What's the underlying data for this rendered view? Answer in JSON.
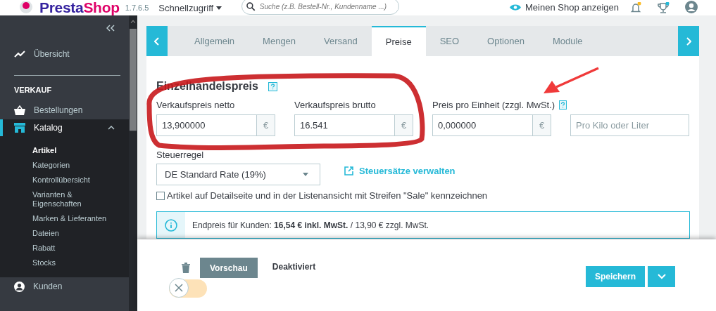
{
  "header": {
    "logo": "PrestaShop",
    "version": "1.7.6.5",
    "quick_access": "Schnellzugriff",
    "search": {
      "placeholder": "Suche (z.B. Bestell-Nr., Kundenname ...)"
    },
    "view_shop": "Meinen Shop anzeigen"
  },
  "sidebar": {
    "top": [
      {
        "label": "Übersicht",
        "kind": "trend"
      }
    ],
    "section": "VERKAUF",
    "items": [
      {
        "label": "Bestellungen",
        "kind": "basket",
        "selected": false
      },
      {
        "label": "Katalog",
        "kind": "store",
        "selected": true,
        "expanded": true,
        "children": [
          {
            "label": "Artikel",
            "selected": true
          },
          {
            "label": "Kategorien",
            "selected": false
          },
          {
            "label": "Kontrollübersicht",
            "selected": false
          },
          {
            "label": "Varianten & Eigenschaften",
            "selected": false
          },
          {
            "label": "Marken & Lieferanten",
            "selected": false
          },
          {
            "label": "Dateien",
            "selected": false
          },
          {
            "label": "Rabatt",
            "selected": false
          },
          {
            "label": "Stocks",
            "selected": false
          }
        ]
      },
      {
        "label": "Kunden",
        "kind": "user",
        "selected": false
      }
    ]
  },
  "tabs": [
    {
      "label": "Allgemein",
      "selected": false
    },
    {
      "label": "Mengen",
      "selected": false
    },
    {
      "label": "Versand",
      "selected": false
    },
    {
      "label": "Preise",
      "selected": true
    },
    {
      "label": "SEO",
      "selected": false
    },
    {
      "label": "Optionen",
      "selected": false
    },
    {
      "label": "Module",
      "selected": false
    }
  ],
  "pricing": {
    "title": "Einzelhandelspreis",
    "fields": [
      {
        "label": "Verkaufspreis netto",
        "value": "13,900000",
        "addon": "€",
        "help": false
      },
      {
        "label": "Verkaufspreis brutto",
        "value": "16.541",
        "addon": "€",
        "help": false
      },
      {
        "label": "Preis pro Einheit (zzgl. MwSt.)",
        "value": "0,000000",
        "addon": "€",
        "help": true
      },
      {
        "placeholder": "Pro Kilo oder Liter",
        "help": false
      }
    ],
    "tax_rule": {
      "label": "Steuerregel",
      "value": "DE Standard Rate (19%)",
      "link": "Steuersätze verwalten"
    },
    "sale_flag": {
      "label": "Artikel auf Detailseite und in der Listenansicht mit Streifen \"Sale\" kennzeichnen",
      "checked": false
    },
    "info": "Endpreis für Kunden: **16,54 € inkl. MwSt.** / 13,90 € zzgl. MwSt."
  },
  "footer": {
    "preview": "Vorschau",
    "status": "Deaktiviert",
    "toggle": {
      "on": false
    },
    "save": "Speichern"
  }
}
